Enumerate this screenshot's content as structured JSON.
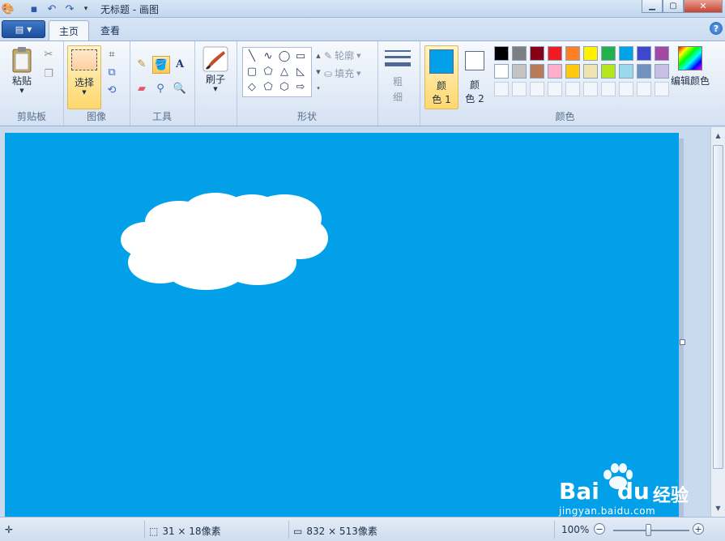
{
  "window": {
    "title": "无标题 - 画图"
  },
  "tabs": [
    {
      "label": "主页"
    },
    {
      "label": "查看"
    }
  ],
  "ribbon": {
    "clipboard": {
      "paste": "粘贴",
      "group": "剪贴板"
    },
    "image": {
      "select": "选择",
      "group": "图像"
    },
    "tools": {
      "group": "工具"
    },
    "brushes": {
      "label": "刷子"
    },
    "shapes": {
      "outline": "轮廓",
      "fill": "填充",
      "group": "形状"
    },
    "size": {
      "label1": "粗",
      "label2": "细"
    },
    "colors": {
      "color1_a": "颜",
      "color1_b": "色 1",
      "color2_a": "颜",
      "color2_b": "色 2",
      "edit": "编辑颜色",
      "group": "颜色",
      "color1_value": "#01a0e8",
      "color2_value": "#ffffff",
      "palette_row1": [
        "#000000",
        "#7f7f7f",
        "#880015",
        "#ed1c24",
        "#ff7f27",
        "#fff200",
        "#22b14c",
        "#00a2e8",
        "#3f48cc",
        "#a349a4"
      ],
      "palette_row2": [
        "#ffffff",
        "#c3c3c3",
        "#b97a57",
        "#ffaec9",
        "#ffc90e",
        "#efe4b0",
        "#b5e61d",
        "#99d9ea",
        "#7092be",
        "#c8bfe7"
      ]
    }
  },
  "canvas": {
    "background": "#01a0e8",
    "cloud_color": "#ffffff"
  },
  "status": {
    "selection_size": "31 × 18像素",
    "image_size": "832 × 513像素",
    "zoom": "100%"
  },
  "watermark": {
    "brand": "Bai",
    "brand2": "du",
    "text": "经验",
    "url": "jingyan.baidu.com"
  }
}
